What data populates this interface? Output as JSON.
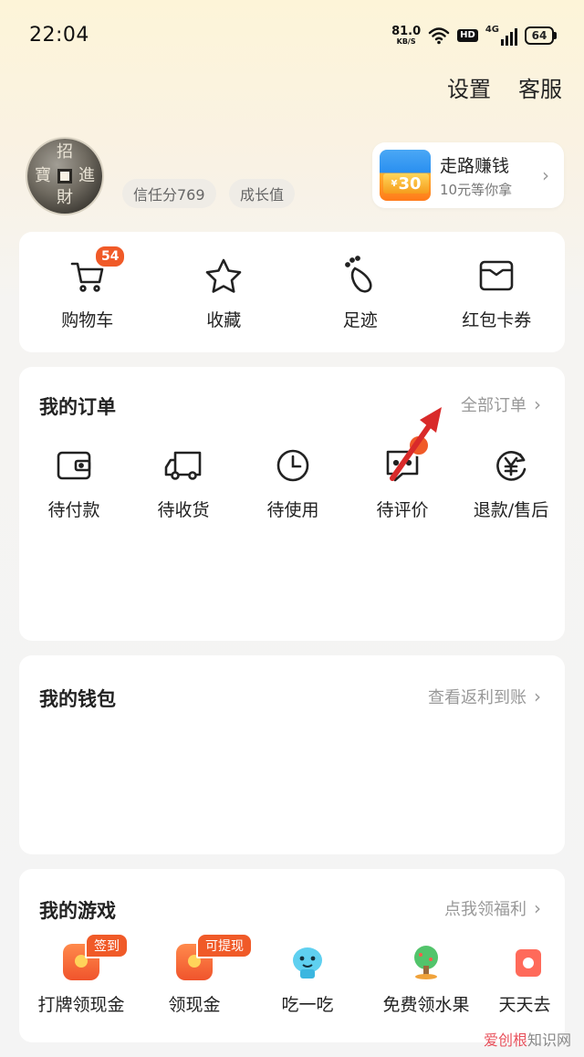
{
  "status_bar": {
    "time": "22:04",
    "net_speed": "81.0",
    "net_unit": "KB/S",
    "hd": "HD",
    "network": "4G",
    "battery": "64"
  },
  "top_links": {
    "settings": "设置",
    "service": "客服"
  },
  "profile": {
    "avatar_chars": [
      "招",
      "進",
      "寶",
      "財"
    ],
    "credit_score": "信任分769",
    "growth": "成长值"
  },
  "promo": {
    "tag": "30",
    "tag_prefix": "¥",
    "title": "走路赚钱",
    "subtitle": "10元等你拿"
  },
  "quick_links": [
    {
      "label": "购物车",
      "icon": "cart-icon",
      "badge": "54"
    },
    {
      "label": "收藏",
      "icon": "star-icon"
    },
    {
      "label": "足迹",
      "icon": "footprint-icon"
    },
    {
      "label": "红包卡券",
      "icon": "wallet-card-icon"
    }
  ],
  "orders": {
    "title": "我的订单",
    "link": "全部订单",
    "items": [
      {
        "label": "待付款",
        "icon": "wallet-icon"
      },
      {
        "label": "待收货",
        "icon": "truck-icon"
      },
      {
        "label": "待使用",
        "icon": "clock-icon"
      },
      {
        "label": "待评价",
        "icon": "comment-icon"
      },
      {
        "label": "退款/售后",
        "icon": "refund-icon"
      }
    ]
  },
  "wallet": {
    "title": "我的钱包",
    "link": "查看返利到账"
  },
  "games": {
    "title": "我的游戏",
    "link": "点我领福利",
    "items": [
      {
        "label": "打牌领现金",
        "tag": "签到",
        "icon": "red-envelope-icon"
      },
      {
        "label": "领现金",
        "tag": "可提现",
        "icon": "red-envelope-icon"
      },
      {
        "label": "吃一吃",
        "icon": "mascot-icon"
      },
      {
        "label": "免费领水果",
        "icon": "fruit-tree-icon"
      },
      {
        "label": "天天去",
        "icon": "game-icon"
      }
    ]
  },
  "watermark": {
    "brand": "爱创根",
    "site": "知识网"
  },
  "colors": {
    "accent": "#f05a28",
    "annotation_arrow": "#d92a2a"
  }
}
